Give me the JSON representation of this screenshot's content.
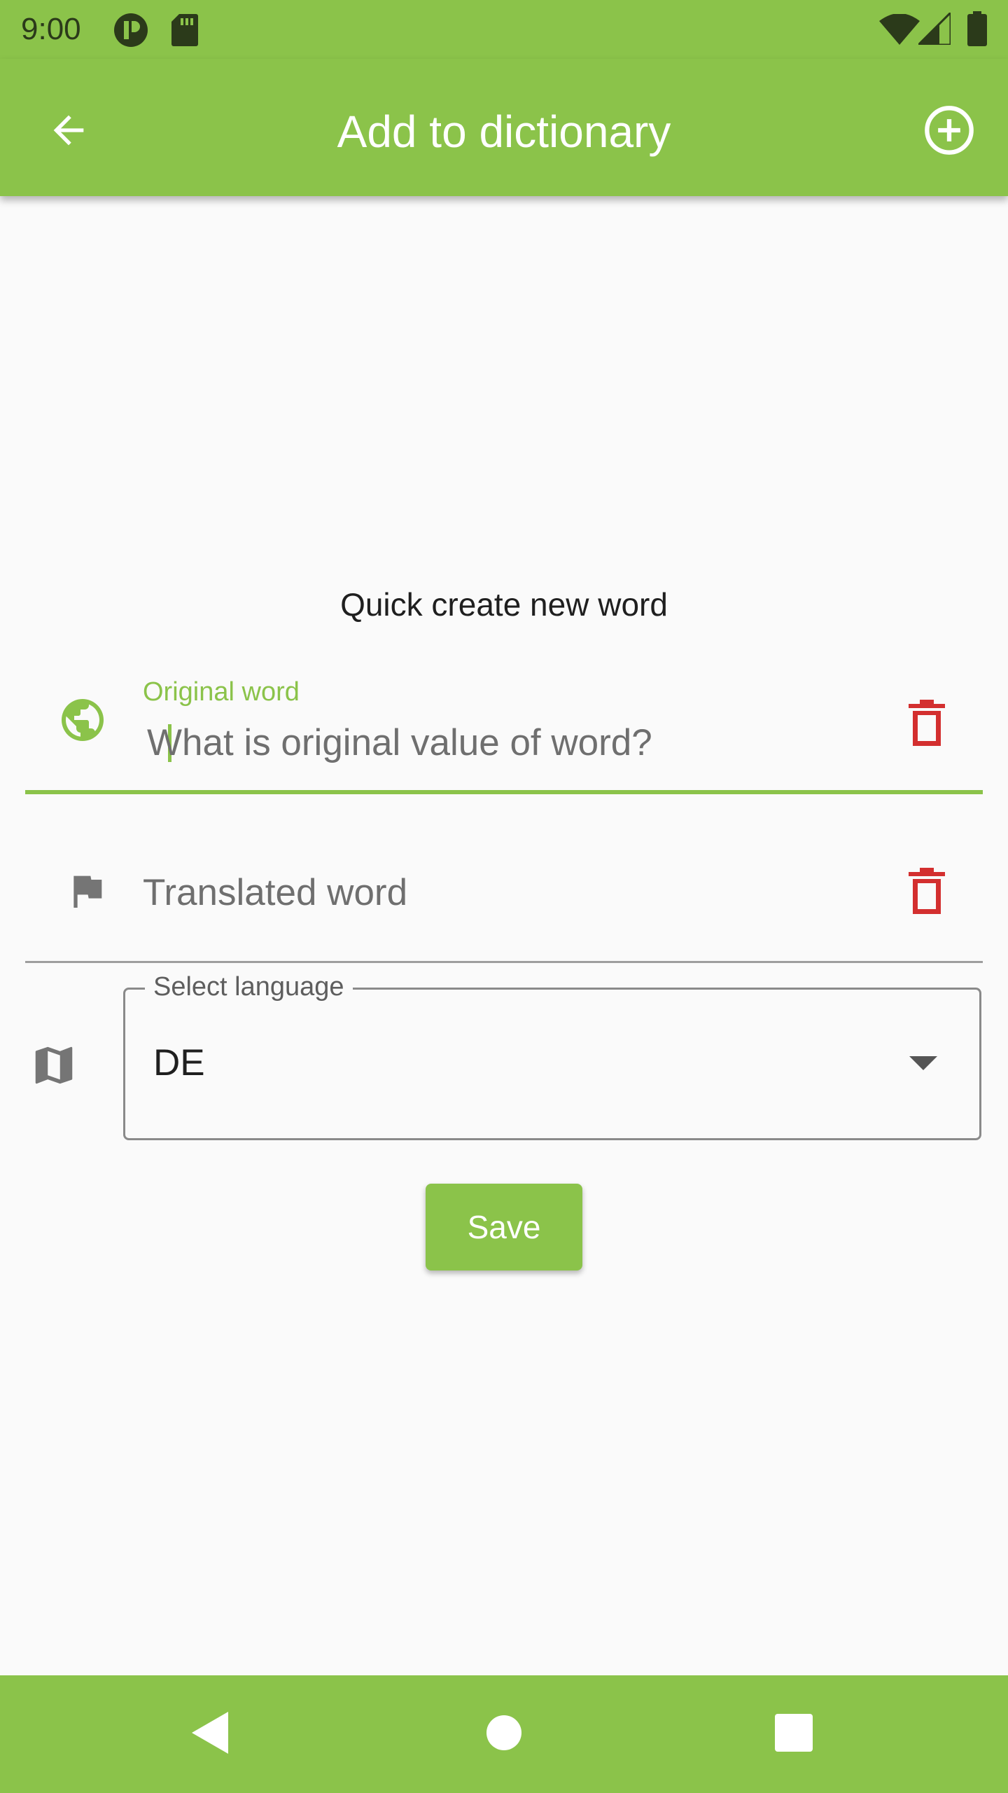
{
  "status_bar": {
    "time": "9:00",
    "icons": [
      "app-notification-icon",
      "sd-card-icon",
      "wifi-icon",
      "signal-icon",
      "battery-icon"
    ]
  },
  "app_bar": {
    "title": "Add to dictionary",
    "back_icon": "arrow-back-icon",
    "add_icon": "add-circle-icon"
  },
  "form": {
    "heading": "Quick create new word",
    "original": {
      "label": "Original word",
      "value": "",
      "placeholder": "What is original value of word?",
      "icon": "globe-icon",
      "delete_icon": "delete-icon",
      "focused": true
    },
    "translated": {
      "value": "",
      "placeholder": "Translated word",
      "icon": "flag-icon",
      "delete_icon": "delete-icon"
    },
    "language": {
      "label": "Select language",
      "value": "DE",
      "icon": "map-icon",
      "arrow_icon": "dropdown-arrow-icon"
    },
    "save_label": "Save"
  },
  "nav_bar": {
    "back_icon": "nav-back-icon",
    "home_icon": "nav-home-icon",
    "recents_icon": "nav-recents-icon"
  },
  "colors": {
    "primary": "#8BC34A",
    "delete": "#D32F2F",
    "background": "#FAFAFA"
  }
}
